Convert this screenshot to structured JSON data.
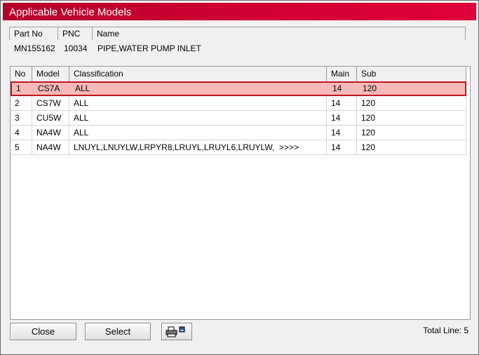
{
  "window": {
    "title": "Applicable Vehicle Models"
  },
  "part": {
    "headers": {
      "part_no": "Part No",
      "pnc": "PNC",
      "name": "Name"
    },
    "values": {
      "part_no": "MN155162",
      "pnc": "10034",
      "name": "PIPE,WATER PUMP INLET"
    }
  },
  "grid": {
    "columns": {
      "no": "No",
      "model": "Model",
      "classification": "Classification",
      "main": "Main",
      "sub": "Sub"
    },
    "rows": [
      {
        "no": "1",
        "model": "CS7A",
        "classification": "ALL",
        "main": "14",
        "sub": "120"
      },
      {
        "no": "2",
        "model": "CS7W",
        "classification": "ALL",
        "main": "14",
        "sub": "120"
      },
      {
        "no": "3",
        "model": "CU5W",
        "classification": "ALL",
        "main": "14",
        "sub": "120"
      },
      {
        "no": "4",
        "model": "NA4W",
        "classification": "ALL",
        "main": "14",
        "sub": "120"
      },
      {
        "no": "5",
        "model": "NA4W",
        "classification": "LNUYL,LNUYLW,LRPYR8,LRUYL,LRUYL6,LRUYLW,  >>>>",
        "main": "14",
        "sub": "120"
      }
    ]
  },
  "footer": {
    "close_label": "Close",
    "select_label": "Select",
    "print_icon": "printer-icon",
    "total_text": "Total Line: 5"
  },
  "colors": {
    "title_bar": "#cc0033",
    "selected_row": "#f7b8b8",
    "selected_border": "#c0141f"
  }
}
